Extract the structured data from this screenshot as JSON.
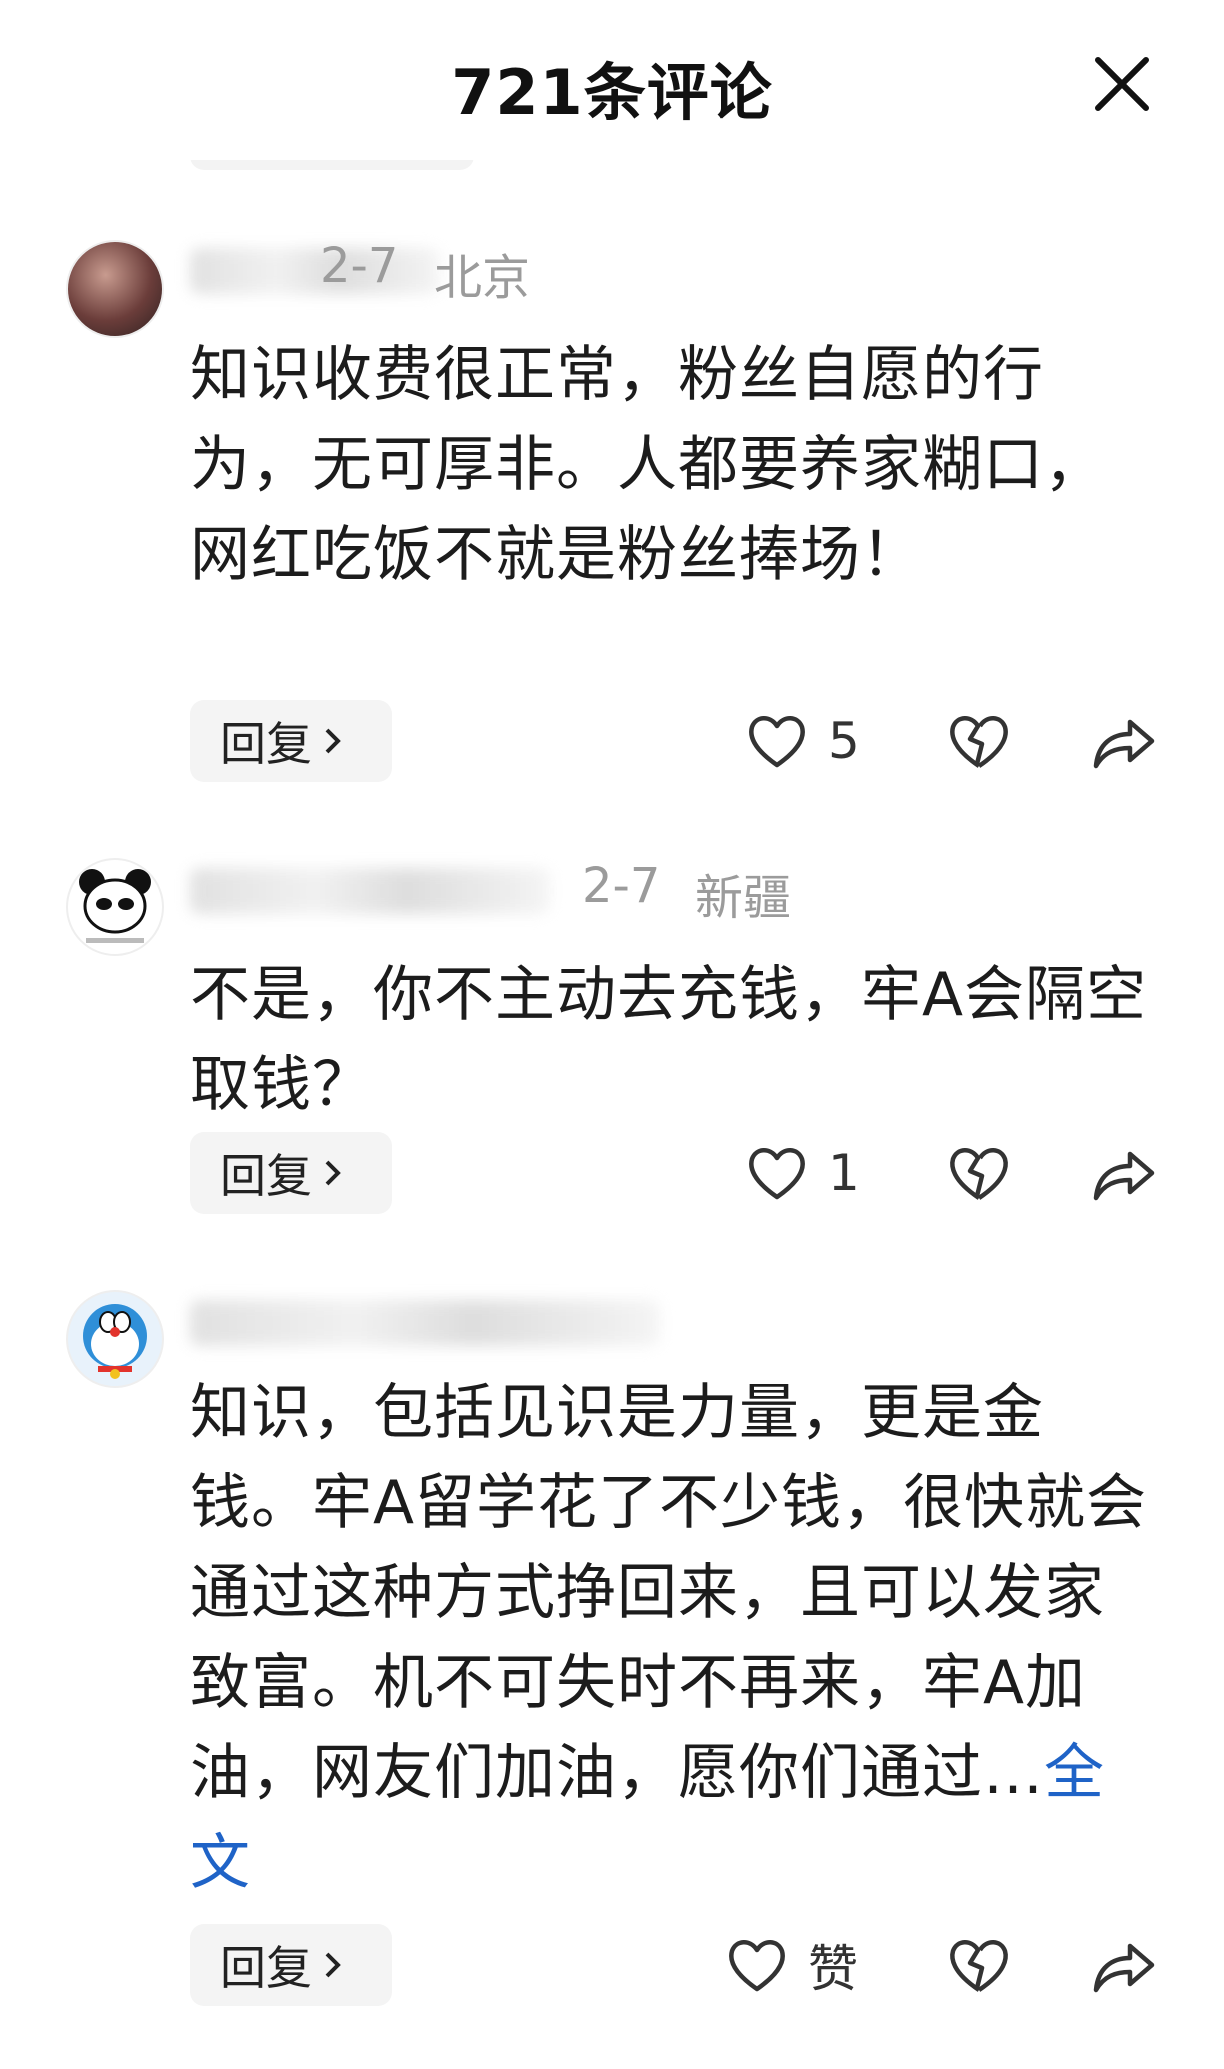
{
  "header": {
    "title": "721条评论"
  },
  "comments": [
    {
      "date": "2-7",
      "location": "北京",
      "text": "知识收费很正常，粉丝自愿的行为，无可厚非。人都要养家糊口，网红吃饭不就是粉丝捧场！",
      "reply_label": "回复",
      "likes": "5"
    },
    {
      "date": "2-7",
      "location": "新疆",
      "text": "不是，你不主动去充钱，牢A会隔空取钱？",
      "reply_label": "回复",
      "likes": "1"
    },
    {
      "text": "知识，包括见识是力量，更是金钱。牢A留学花了不少钱，很快就会通过这种方式挣回来，且可以发家致富。机不可失时不再来，牢A加油，网友们加油，愿你们通过…",
      "more_label": "全文",
      "reply_label": "回复",
      "likes": "赞"
    }
  ],
  "colors": {
    "link": "#1f63c7",
    "meta": "#9b9b9b",
    "reply_bg": "#f4f4f4"
  }
}
